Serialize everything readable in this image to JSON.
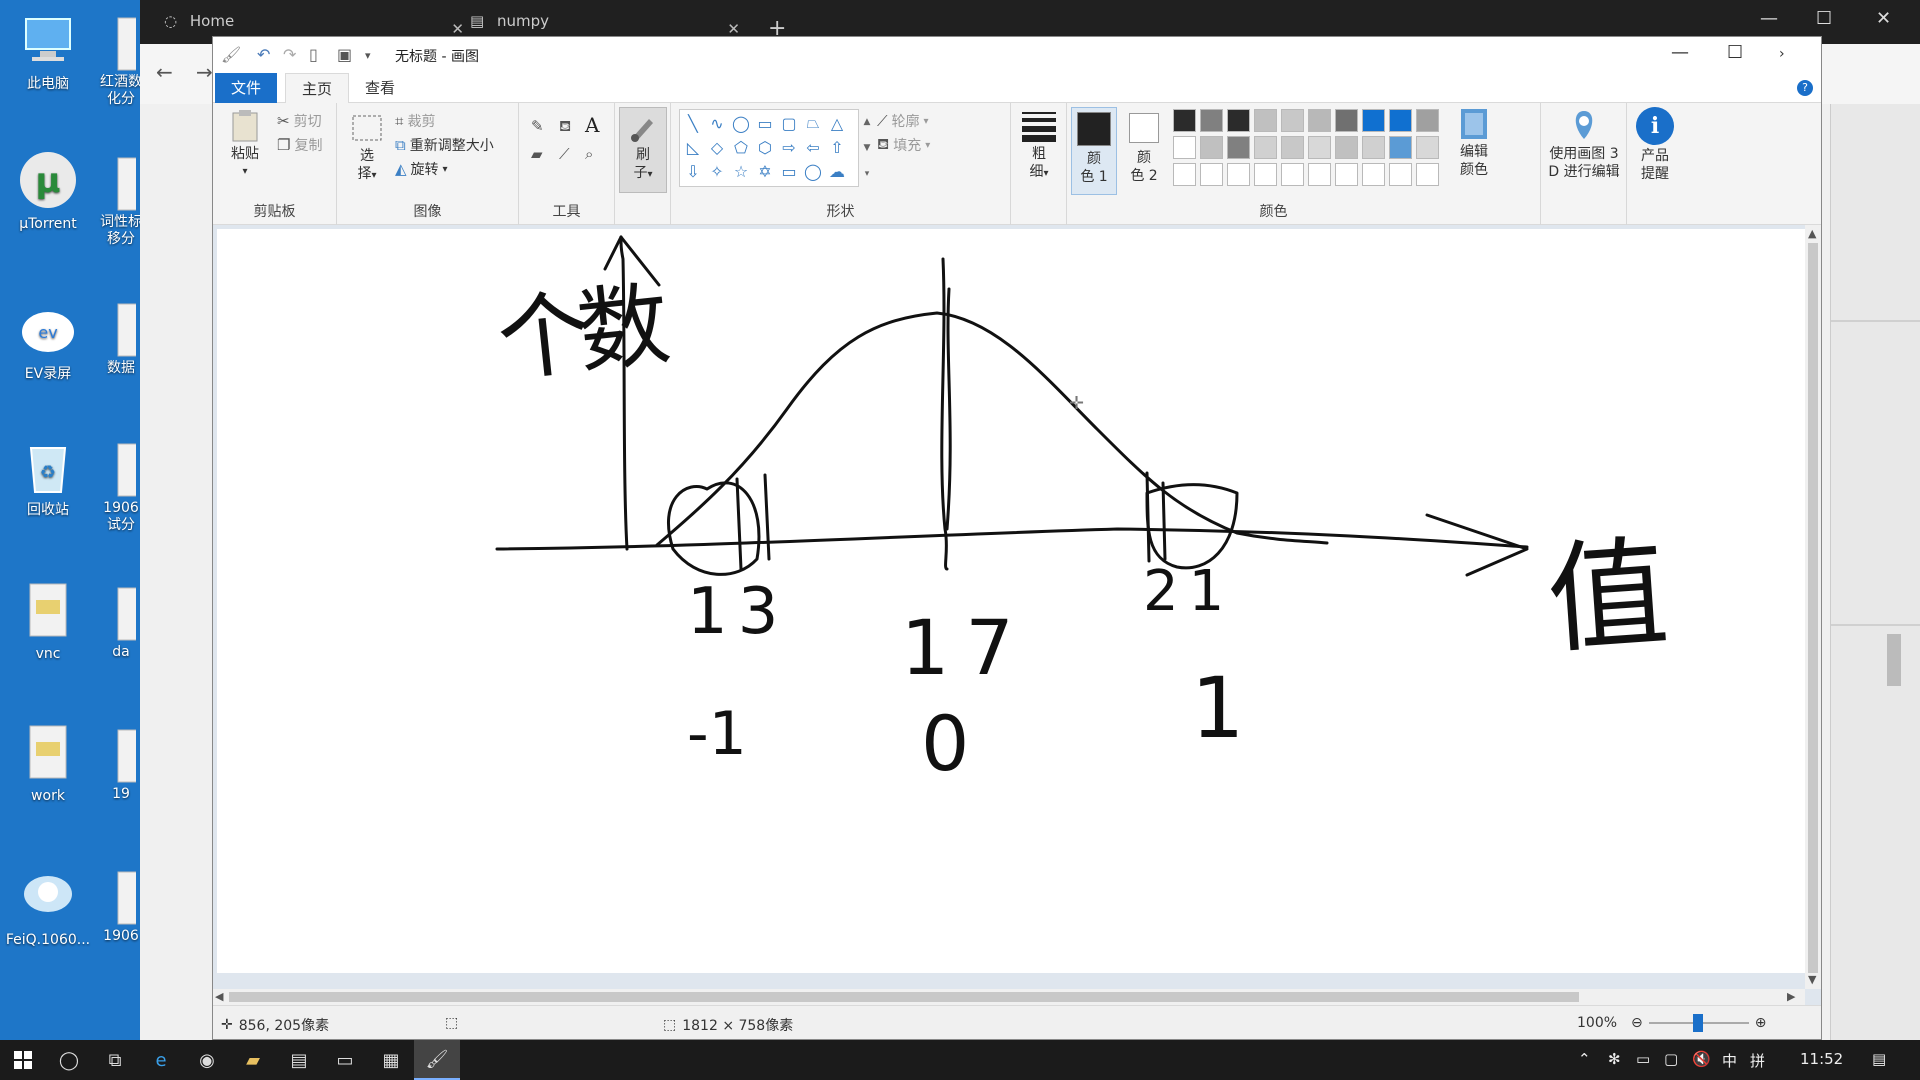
{
  "desktop": {
    "icons": [
      {
        "label": "此电脑",
        "icon": "computer-icon"
      },
      {
        "label": "μTorrent",
        "icon": "utorrent-icon"
      },
      {
        "label": "EV录屏",
        "icon": "ev-recorder-icon"
      },
      {
        "label": "回收站",
        "icon": "recycle-bin-icon"
      },
      {
        "label": "vnc",
        "icon": "folder-icon"
      },
      {
        "label": "work",
        "icon": "folder-icon"
      },
      {
        "label": "FeiQ.1060...",
        "icon": "feiq-icon"
      }
    ],
    "icons_col2": [
      {
        "label": "红酒数",
        "label2": "化分",
        "icon": "document-icon"
      },
      {
        "label": "词性标",
        "label2": "移分",
        "icon": "document-icon"
      },
      {
        "label": "数据",
        "icon": "document-icon"
      },
      {
        "label": "1906",
        "label2": "试分",
        "icon": "document-icon"
      },
      {
        "label": "da",
        "icon": "document-icon"
      },
      {
        "label": "19",
        "icon": "document-icon"
      },
      {
        "label": "1906",
        "icon": "document-icon"
      }
    ]
  },
  "browser": {
    "tabs": [
      {
        "label": "Home",
        "icon": "loading-icon"
      },
      {
        "label": "numpy",
        "icon": "document-icon"
      }
    ]
  },
  "paint": {
    "title": "无标题 - 画图",
    "tabs": {
      "file": "文件",
      "home": "主页",
      "view": "查看"
    },
    "clipboard": {
      "paste": "粘贴",
      "cut": "剪切",
      "copy": "复制",
      "group": "剪贴板"
    },
    "image": {
      "select_line1": "选",
      "select_line2": "择",
      "crop": "裁剪",
      "resize": "重新调整大小",
      "rotate": "旋转",
      "group": "图像"
    },
    "tools": {
      "group": "工具",
      "text_tool": "A"
    },
    "brushes": {
      "line1": "刷",
      "line2": "子"
    },
    "shapes": {
      "outline": "轮廓",
      "fill": "填充",
      "group": "形状"
    },
    "size": {
      "line1": "粗",
      "line2": "细"
    },
    "colors": {
      "color1_line1": "颜",
      "color1_line2": "色 1",
      "color2_line1": "颜",
      "color2_line2": "色 2",
      "edit_line1": "编辑",
      "edit_line2": "颜色",
      "group": "颜色",
      "palette_row1": [
        "#2b2b2b",
        "#808080",
        "#2b2b2b",
        "#c0c0c0",
        "#c8c8c8",
        "#b8b8b8",
        "#707070",
        "#1070d0",
        "#1070d0",
        "#a0a0a0"
      ],
      "palette_row2": [
        "#ffffff",
        "#c0c0c0",
        "#808080",
        "#d0d0d0",
        "#c8c8c8",
        "#d8d8d8",
        "#c0c0c0",
        "#d0d0d0",
        "#5b9bd5",
        "#d8d8d8"
      ],
      "palette_row3": [
        "#ffffff",
        "#ffffff",
        "#ffffff",
        "#ffffff",
        "#ffffff",
        "#ffffff",
        "#ffffff",
        "#ffffff",
        "#ffffff",
        "#ffffff"
      ]
    },
    "paint3d": {
      "line1": "使用画图 3",
      "line2": "D 进行编辑"
    },
    "product": {
      "line1": "产品",
      "line2": "提醒"
    },
    "drawing": {
      "y_label": "个数",
      "x_label": "值",
      "tick_left": "13",
      "tick_mid": "17",
      "tick_right": "21",
      "std_left": "-1",
      "std_mid": "0",
      "std_right": "1"
    },
    "status": {
      "cursor": "856, 205像素",
      "canvas_size": "1812 × 758像素",
      "zoom": "100%"
    }
  },
  "taskbar": {
    "time": "11:52",
    "ime_lang": "中",
    "ime_mode": "拼"
  }
}
